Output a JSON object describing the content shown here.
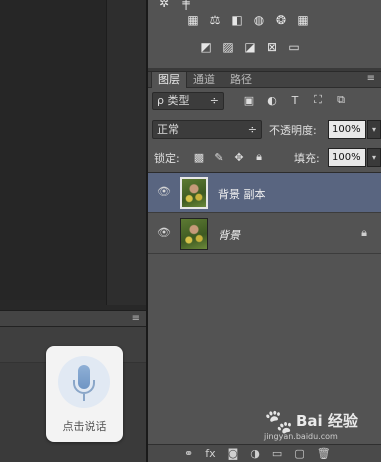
{
  "panels": {
    "tabs": [
      {
        "label": "图层",
        "active": true
      },
      {
        "label": "通道",
        "active": false
      },
      {
        "label": "路径",
        "active": false
      }
    ],
    "tabs_menu": "≡"
  },
  "filter": {
    "kind_label": "ρ 类型",
    "kind_arrow": "÷"
  },
  "blend": {
    "mode": "正常",
    "mode_arrow": "÷",
    "opacity_label": "不透明度:",
    "opacity_value": "100%",
    "drop_arrow": "▾"
  },
  "lock": {
    "label": "锁定:",
    "fill_label": "填充:",
    "fill_value": "100%",
    "drop_arrow": "▾"
  },
  "layers": [
    {
      "name": "背景 副本",
      "selected": true,
      "locked": false
    },
    {
      "name": "背景",
      "selected": false,
      "locked": true
    }
  ],
  "voice": {
    "label": "点击说话"
  },
  "watermark": {
    "brand": "Bai 经验",
    "url": "jingyan.baidu.com"
  },
  "mini_panel": {
    "menu": "≡"
  },
  "icons": {
    "eye": "eye-icon",
    "lock": "lock-icon"
  }
}
